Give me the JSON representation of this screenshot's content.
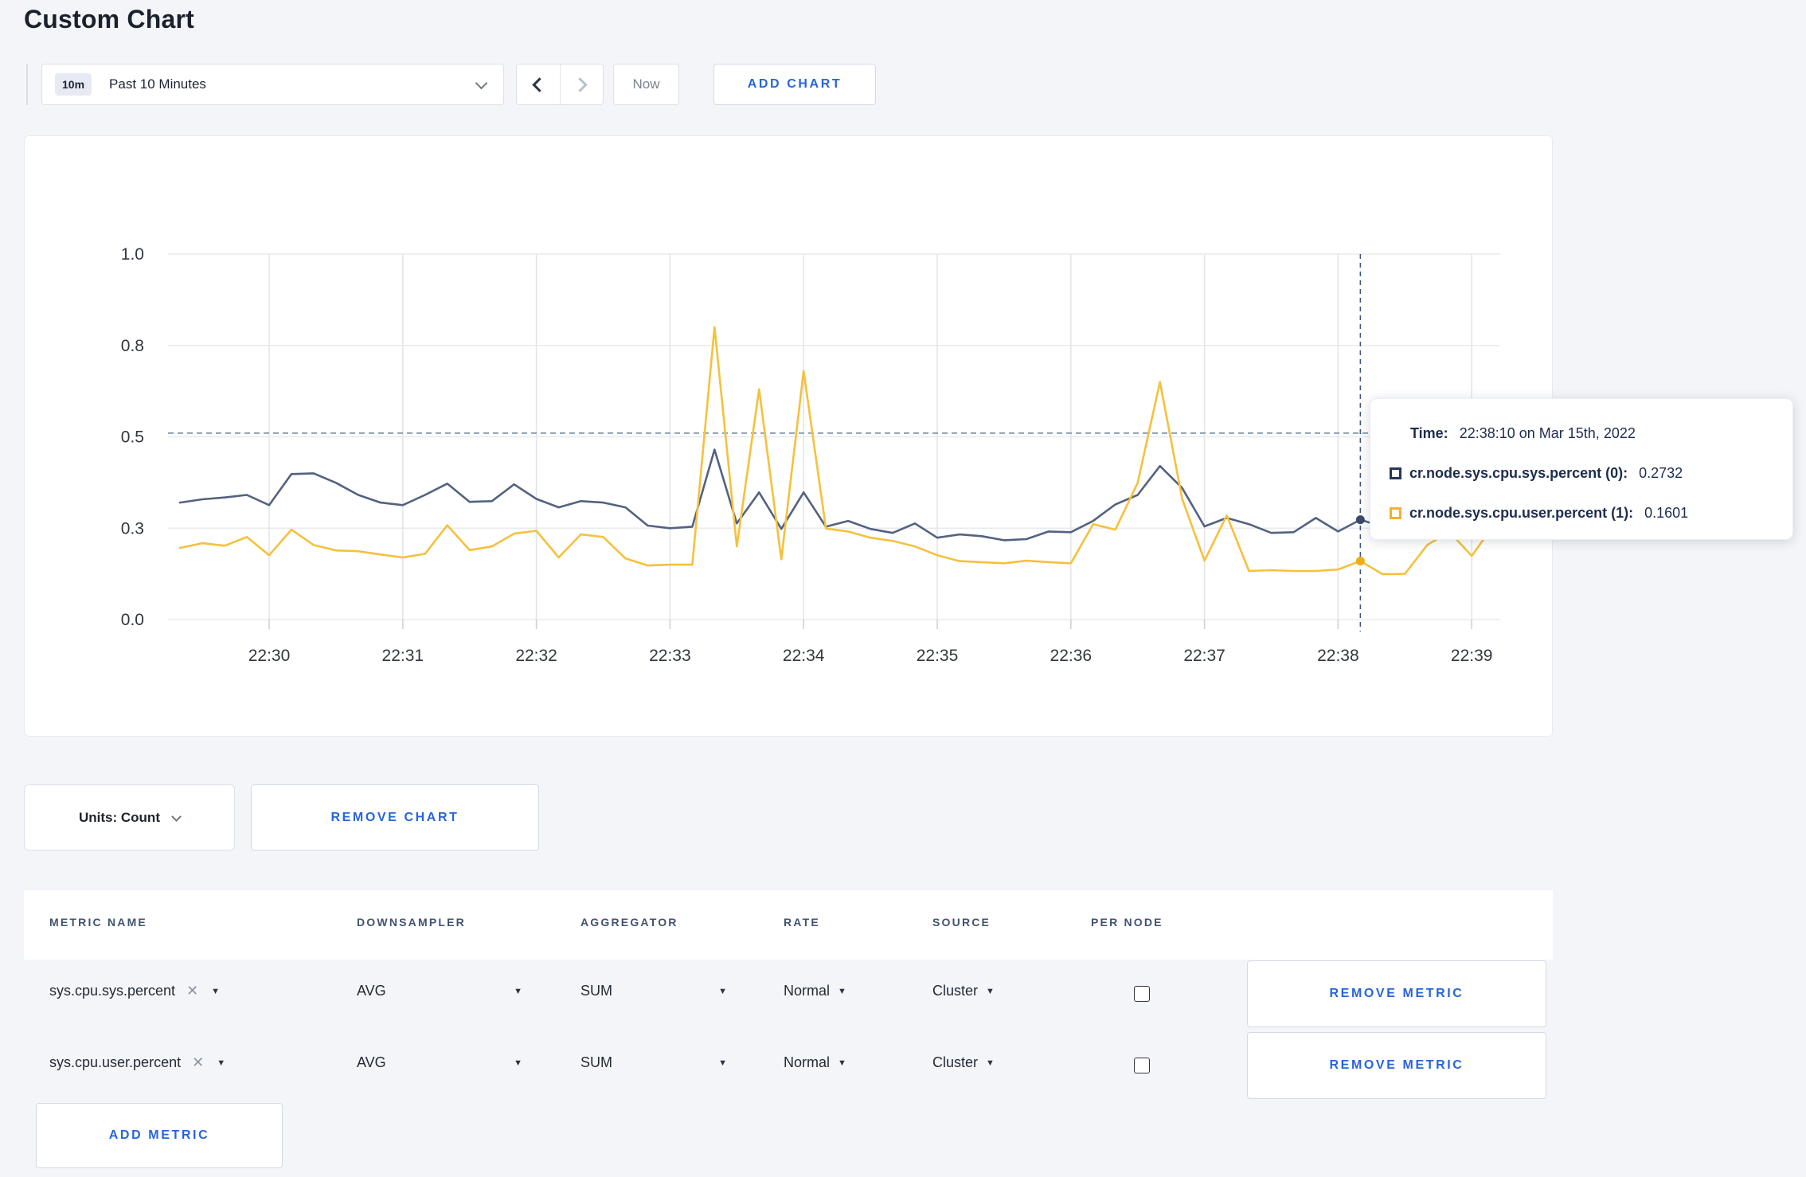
{
  "page": {
    "title": "Custom Chart",
    "background": "#f4f5f9",
    "accent_blue": "#2765d9"
  },
  "toolbar": {
    "time_window_badge": "10m",
    "time_window_label": "Past 10 Minutes",
    "now_label": "Now",
    "add_chart_label": "ADD CHART"
  },
  "tooltip": {
    "time_label": "Time:",
    "time_value": "22:38:10 on Mar 15th, 2022",
    "series": [
      {
        "label": "cr.node.sys.cpu.sys.percent (0):",
        "value": "0.2732",
        "color": "#26355b"
      },
      {
        "label": "cr.node.sys.cpu.user.percent (1):",
        "value": "0.1601",
        "color": "#f1b226"
      }
    ]
  },
  "units_bar": {
    "units_label": "Units: Count",
    "remove_chart_label": "REMOVE CHART"
  },
  "metrics_table": {
    "columns": [
      "METRIC NAME",
      "DOWNSAMPLER",
      "AGGREGATOR",
      "RATE",
      "SOURCE",
      "PER NODE"
    ],
    "remove_metric_label": "REMOVE METRIC",
    "add_metric_label": "ADD METRIC",
    "rows": [
      {
        "metric": "sys.cpu.sys.percent",
        "downsampler": "AVG",
        "aggregator": "SUM",
        "rate": "Normal",
        "source": "Cluster",
        "per_node_checked": false
      },
      {
        "metric": "sys.cpu.user.percent",
        "downsampler": "AVG",
        "aggregator": "SUM",
        "rate": "Normal",
        "source": "Cluster",
        "per_node_checked": false
      }
    ]
  },
  "chart_data": {
    "type": "line",
    "title": "",
    "xlabel": "",
    "ylabel": "",
    "ylim": [
      0,
      1
    ],
    "grid": true,
    "x_tick_unit": "time (HH:MM), t = seconds relative to 22:30:00",
    "x_ticks": [
      "22:30",
      "22:31",
      "22:32",
      "22:33",
      "22:34",
      "22:35",
      "22:36",
      "22:37",
      "22:38",
      "22:39"
    ],
    "y_ticks": [
      {
        "label": "0.0",
        "value": 0.0
      },
      {
        "label": "0.3",
        "value": 0.25
      },
      {
        "label": "0.5",
        "value": 0.5
      },
      {
        "label": "0.8",
        "value": 0.75
      },
      {
        "label": "1.0",
        "value": 1.0
      }
    ],
    "threshold_line_value": 0.51,
    "crosshair": {
      "t": 490,
      "time": "22:38:10 on Mar 15th, 2022"
    },
    "series": [
      {
        "name": "cr.node.sys.cpu.sys.percent",
        "color": "#53627f",
        "dot_color": "#3a4a68",
        "hover_value": 0.2732,
        "points": [
          [
            -40,
            0.32
          ],
          [
            -30,
            0.329
          ],
          [
            -20,
            0.334
          ],
          [
            -10,
            0.341
          ],
          [
            0,
            0.313
          ],
          [
            10,
            0.398
          ],
          [
            20,
            0.4
          ],
          [
            30,
            0.374
          ],
          [
            40,
            0.341
          ],
          [
            50,
            0.32
          ],
          [
            60,
            0.313
          ],
          [
            70,
            0.341
          ],
          [
            80,
            0.372
          ],
          [
            90,
            0.322
          ],
          [
            100,
            0.324
          ],
          [
            110,
            0.37
          ],
          [
            120,
            0.33
          ],
          [
            130,
            0.307
          ],
          [
            140,
            0.324
          ],
          [
            150,
            0.32
          ],
          [
            160,
            0.307
          ],
          [
            170,
            0.257
          ],
          [
            180,
            0.25
          ],
          [
            190,
            0.254
          ],
          [
            200,
            0.465
          ],
          [
            210,
            0.263
          ],
          [
            220,
            0.348
          ],
          [
            230,
            0.248
          ],
          [
            240,
            0.348
          ],
          [
            250,
            0.254
          ],
          [
            260,
            0.27
          ],
          [
            270,
            0.248
          ],
          [
            280,
            0.237
          ],
          [
            290,
            0.263
          ],
          [
            300,
            0.224
          ],
          [
            310,
            0.233
          ],
          [
            320,
            0.228
          ],
          [
            330,
            0.217
          ],
          [
            340,
            0.22
          ],
          [
            350,
            0.241
          ],
          [
            360,
            0.239
          ],
          [
            370,
            0.27
          ],
          [
            380,
            0.315
          ],
          [
            390,
            0.341
          ],
          [
            400,
            0.42
          ],
          [
            410,
            0.36
          ],
          [
            420,
            0.255
          ],
          [
            430,
            0.278
          ],
          [
            440,
            0.261
          ],
          [
            450,
            0.237
          ],
          [
            460,
            0.239
          ],
          [
            470,
            0.278
          ],
          [
            480,
            0.241
          ],
          [
            490,
            0.2732
          ],
          [
            500,
            0.254
          ],
          [
            510,
            0.262
          ],
          [
            520,
            0.27
          ],
          [
            530,
            0.265
          ],
          [
            540,
            0.272
          ],
          [
            550,
            0.268
          ]
        ]
      },
      {
        "name": "cr.node.sys.cpu.user.percent",
        "color": "#f5c13d",
        "dot_color": "#efac15",
        "hover_value": 0.1601,
        "points": [
          [
            -40,
            0.196
          ],
          [
            -30,
            0.209
          ],
          [
            -20,
            0.202
          ],
          [
            -10,
            0.226
          ],
          [
            0,
            0.176
          ],
          [
            10,
            0.246
          ],
          [
            20,
            0.204
          ],
          [
            30,
            0.189
          ],
          [
            40,
            0.187
          ],
          [
            50,
            0.178
          ],
          [
            60,
            0.17
          ],
          [
            70,
            0.18
          ],
          [
            80,
            0.258
          ],
          [
            90,
            0.19
          ],
          [
            100,
            0.2
          ],
          [
            110,
            0.235
          ],
          [
            120,
            0.243
          ],
          [
            130,
            0.17
          ],
          [
            140,
            0.233
          ],
          [
            150,
            0.226
          ],
          [
            160,
            0.167
          ],
          [
            170,
            0.148
          ],
          [
            180,
            0.15
          ],
          [
            190,
            0.15
          ],
          [
            200,
            0.8
          ],
          [
            210,
            0.2
          ],
          [
            220,
            0.63
          ],
          [
            230,
            0.165
          ],
          [
            240,
            0.68
          ],
          [
            250,
            0.249
          ],
          [
            260,
            0.241
          ],
          [
            270,
            0.224
          ],
          [
            280,
            0.215
          ],
          [
            290,
            0.2
          ],
          [
            300,
            0.176
          ],
          [
            310,
            0.16
          ],
          [
            320,
            0.157
          ],
          [
            330,
            0.154
          ],
          [
            340,
            0.161
          ],
          [
            350,
            0.157
          ],
          [
            360,
            0.154
          ],
          [
            370,
            0.261
          ],
          [
            380,
            0.246
          ],
          [
            390,
            0.374
          ],
          [
            400,
            0.65
          ],
          [
            410,
            0.33
          ],
          [
            420,
            0.161
          ],
          [
            430,
            0.285
          ],
          [
            440,
            0.133
          ],
          [
            450,
            0.135
          ],
          [
            460,
            0.133
          ],
          [
            470,
            0.133
          ],
          [
            480,
            0.137
          ],
          [
            490,
            0.1601
          ],
          [
            500,
            0.124
          ],
          [
            510,
            0.125
          ],
          [
            520,
            0.204
          ],
          [
            530,
            0.24
          ],
          [
            540,
            0.174
          ],
          [
            550,
            0.26
          ]
        ]
      }
    ],
    "legend_position": "tooltip-only"
  }
}
